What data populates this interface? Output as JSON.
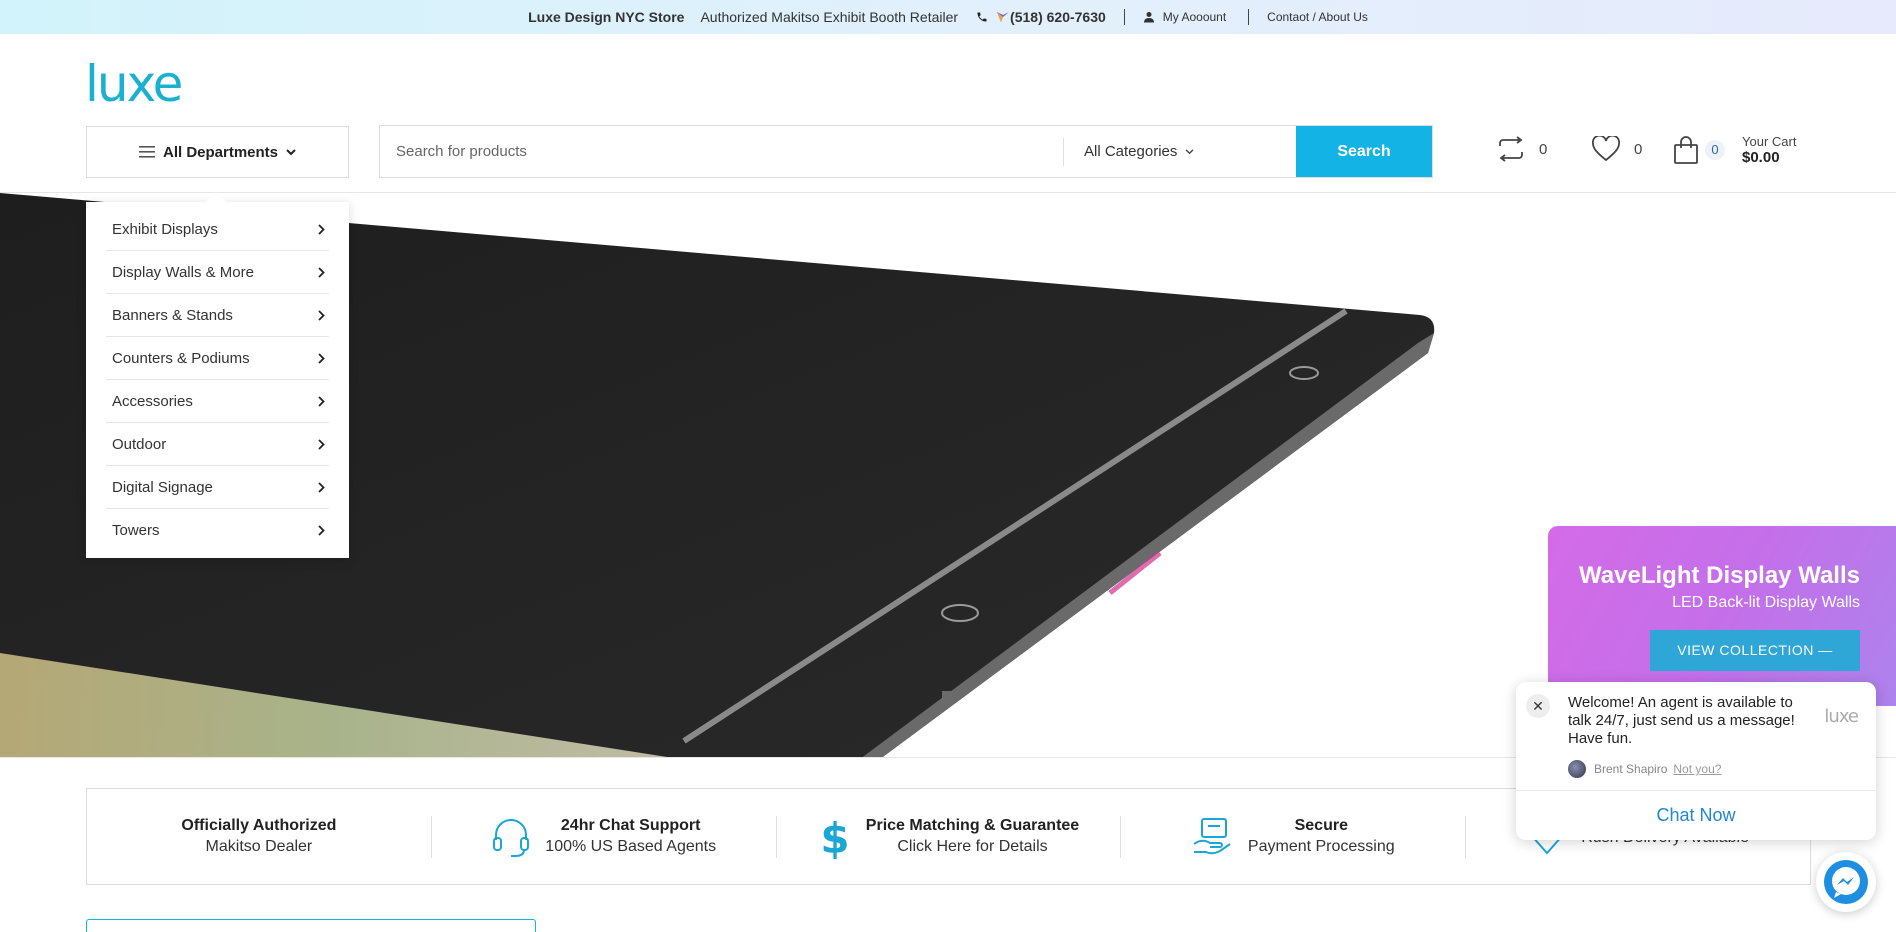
{
  "topbar": {
    "store_name": "Luxe Design NYC Store",
    "tagline": "Authorized Makitso Exhibit Booth Retailer",
    "phone": "(518) 620-7630",
    "account": "My Aooount",
    "contact": "Contaot / About Us"
  },
  "header": {
    "logo": "luxe",
    "departments_label": "All Departments",
    "search_placeholder": "Search for products",
    "category_label": "All Categories",
    "search_button": "Search",
    "compare_count": "0",
    "wishlist_count": "0",
    "cart_count": "0",
    "cart_label": "Your Cart",
    "cart_total": "$0.00"
  },
  "departments": [
    {
      "label": "Exhibit Displays"
    },
    {
      "label": "Display Walls & More"
    },
    {
      "label": "Banners & Stands"
    },
    {
      "label": "Counters & Podiums"
    },
    {
      "label": "Accessories"
    },
    {
      "label": "Outdoor"
    },
    {
      "label": "Digital Signage"
    },
    {
      "label": "Towers"
    }
  ],
  "promo": {
    "title": "WaveLight Display Walls",
    "subtitle": "LED Back-lit Display Walls",
    "button": "VIEW COLLECTION —"
  },
  "chat": {
    "message": "Welcome! An agent is available to talk 24/7, just send us a message! Have fun.",
    "logo": "luxe",
    "agent_name": "Brent Shapiro",
    "not_you": "Not you?",
    "chat_now": "Chat Now"
  },
  "features": [
    {
      "title": "Officially Authorized",
      "subtitle": "Makitso Dealer",
      "icon": "none"
    },
    {
      "title": "24hr Chat Support",
      "subtitle": "100% US Based Agents",
      "icon": "headset-icon"
    },
    {
      "title": "Price Matching & Guarantee",
      "subtitle": "Click Here for Details",
      "icon": "dollar-icon"
    },
    {
      "title": "Secure",
      "subtitle": "Payment Processing",
      "icon": "secure-payment-icon"
    },
    {
      "title": "",
      "subtitle": "Rush Delivery Available",
      "icon": "diamond-icon"
    }
  ],
  "colors": {
    "accent": "#14b3e6",
    "logo": "#19b1cf",
    "promo_purple": "#c46fe9",
    "chat_link": "#1f86d8"
  }
}
